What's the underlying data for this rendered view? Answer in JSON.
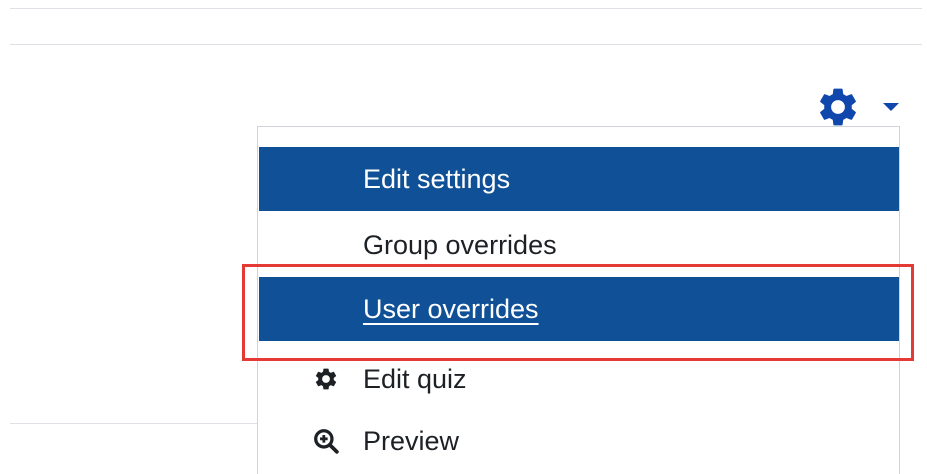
{
  "settings_menu": {
    "toggle_icon": "gear-icon",
    "caret_icon": "caret-down-icon",
    "accent_color": "#0f47ad",
    "items": [
      {
        "label": "Edit settings",
        "icon": "",
        "active": true
      },
      {
        "label": "Group overrides",
        "icon": "",
        "active": false
      },
      {
        "label": "User overrides",
        "icon": "",
        "active": true,
        "focused": true
      },
      {
        "label": "Edit quiz",
        "icon": "gear-icon",
        "active": false
      },
      {
        "label": "Preview",
        "icon": "zoom-in-icon",
        "active": false
      }
    ],
    "active_color": "#0f5096"
  },
  "annotation": {
    "highlight_color": "#e53935",
    "highlighted_item": "User overrides"
  }
}
